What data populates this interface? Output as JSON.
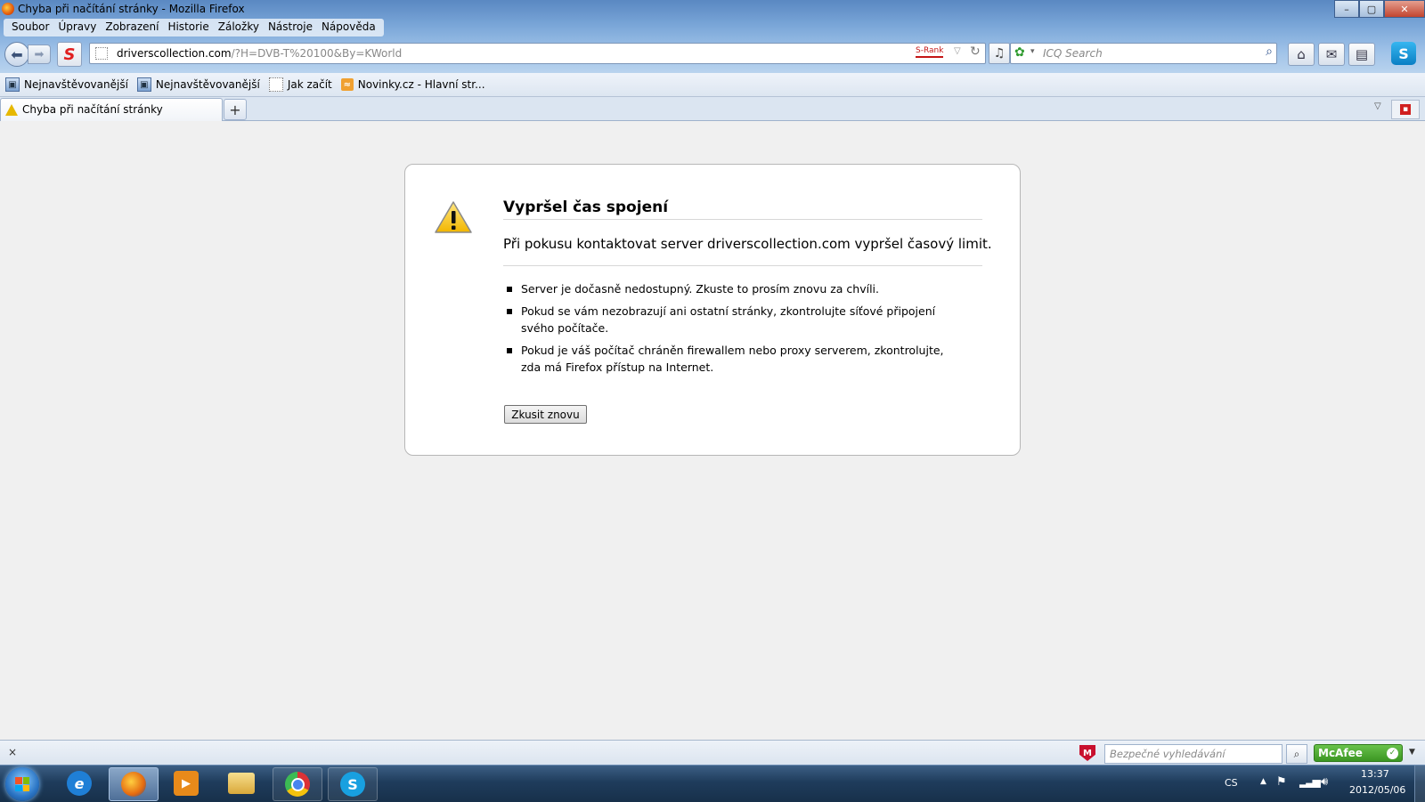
{
  "window": {
    "title": "Chyba při načítání stránky - Mozilla Firefox",
    "controls": {
      "minimize": "–",
      "maximize": "▢",
      "close": "✕"
    }
  },
  "menu": [
    {
      "label": "Soubor"
    },
    {
      "label": "Úpravy"
    },
    {
      "label": "Zobrazení"
    },
    {
      "label": "Historie"
    },
    {
      "label": "Záložky"
    },
    {
      "label": "Nástroje"
    },
    {
      "label": "Nápověda"
    }
  ],
  "navbar": {
    "url_host": "driverscollection.com",
    "url_path": "/?H=DVB-T%20100&By=KWorld",
    "srank_label": "S-Rank",
    "search_placeholder": "ICQ Search",
    "icons": [
      "back-icon",
      "forward-icon",
      "s-icon",
      "reload-icon",
      "music-icon",
      "icq-icon",
      "search-icon",
      "home-icon",
      "mail-icon",
      "book-icon",
      "skype-icon"
    ]
  },
  "bookmarks": [
    {
      "label": "Nejnavštěvovanější",
      "icon": "most-visited-icon"
    },
    {
      "label": "Nejnavštěvovanější",
      "icon": "most-visited-icon"
    },
    {
      "label": "Jak začít",
      "icon": "page-icon"
    },
    {
      "label": "Novinky.cz - Hlavní str...",
      "icon": "rss-icon"
    }
  ],
  "tab": {
    "label": "Chyba při načítání stránky",
    "new_tab": "+"
  },
  "error": {
    "title": "Vypršel čas spojení",
    "short_desc": "Při pokusu kontaktovat server driverscollection.com vypršel časový limit.",
    "items": [
      "Server je dočasně nedostupný. Zkuste to prosím znovu za chvíli.",
      "Pokud se vám nezobrazují ani ostatní stránky, zkontrolujte síťové připojení svého počítače.",
      "Pokud je váš počítač chráněn firewallem nebo proxy serverem, zkontrolujte, zda má Firefox přístup na Internet."
    ],
    "retry_label": "Zkusit znovu"
  },
  "statusbar": {
    "close": "×",
    "safe_search_placeholder": "Bezpečné vyhledávání",
    "mcafee_label": "McAfee"
  },
  "taskbar": {
    "apps": [
      {
        "name": "internet-explorer",
        "glyph": "e",
        "color": "#1f7fd6"
      },
      {
        "name": "firefox",
        "glyph": "",
        "color": "#e46a10"
      },
      {
        "name": "media-player",
        "glyph": "▶",
        "color": "#e88a1a"
      },
      {
        "name": "explorer",
        "glyph": "",
        "color": "#e8c25a"
      },
      {
        "name": "chrome",
        "glyph": "",
        "color": "#3a8a3a"
      },
      {
        "name": "skype",
        "glyph": "S",
        "color": "#18a0e0"
      }
    ],
    "language": "CS",
    "time": "13:37",
    "date": "2012/05/06"
  }
}
